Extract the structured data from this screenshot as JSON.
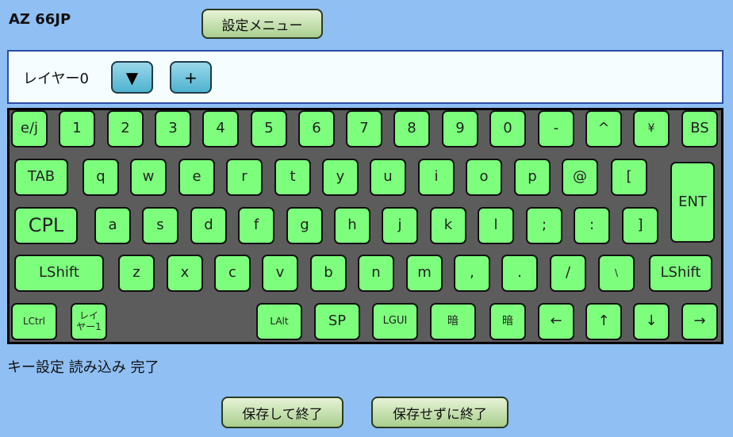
{
  "app": {
    "title": "AZ 66JP",
    "settings_menu_label": "設定メニュー"
  },
  "layer": {
    "label": "レイヤー0",
    "dropdown_label": "▼",
    "add_label": "+"
  },
  "keyboard": {
    "key_color": "#7dff7d",
    "rows": [
      [
        "e/j",
        "1",
        "2",
        "3",
        "4",
        "5",
        "6",
        "7",
        "8",
        "9",
        "0",
        "-",
        "^",
        "¥",
        "BS"
      ],
      [
        "TAB",
        "q",
        "w",
        "e",
        "r",
        "t",
        "y",
        "u",
        "i",
        "o",
        "p",
        "@",
        "[",
        "ENT"
      ],
      [
        "CPL",
        "a",
        "s",
        "d",
        "f",
        "g",
        "h",
        "j",
        "k",
        "l",
        ";",
        ":",
        "]"
      ],
      [
        "LShift",
        "z",
        "x",
        "c",
        "v",
        "b",
        "n",
        "m",
        ",",
        ".",
        "/",
        "\\",
        "LShift"
      ],
      [
        "LCtrl",
        "レイ\nヤー1",
        "LAlt",
        "SP",
        "LGUI",
        "暗",
        "暗",
        "←",
        "↑",
        "↓",
        "→"
      ]
    ]
  },
  "status": {
    "message": "キー設定 読み込み 完了"
  },
  "footer": {
    "save_exit_label": "保存して終了",
    "exit_nosave_label": "保存せずに終了"
  }
}
